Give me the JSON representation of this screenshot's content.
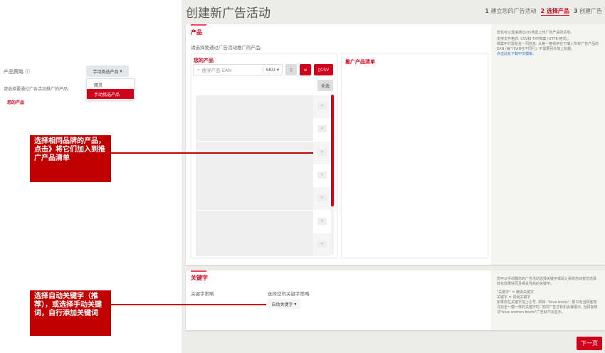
{
  "left_panel": {
    "strategy_label": "产品策略",
    "help_icon": "question-circle-icon",
    "strategy_button": "手动挑选产品",
    "dropdown_options": [
      "精灵",
      "手动挑选产品"
    ],
    "selected_option": "手动挑选产品",
    "prompt": "请选择要通过广告活动推广的产品:",
    "your_products": "您的产品"
  },
  "header": {
    "title": "创建新广告活动",
    "steps": [
      {
        "num": "1",
        "label": "建立您的广告活动"
      },
      {
        "num": "2",
        "label": "选择产品"
      },
      {
        "num": "3",
        "label": "创建广告"
      }
    ],
    "active_step": 2
  },
  "products": {
    "section_title": "产品",
    "prompt": "请选择要通过广告活动推广的产品:",
    "your_products": "您的产品",
    "search_placeholder": "搜寻产品 EAN",
    "search_type": "SKU",
    "csv_button": "CSV",
    "select_all": "全选",
    "move_glyph": "»",
    "row_count": 7,
    "target_title": "推广产品清单",
    "help": {
      "line1": "您也可以直接通过csv档案上传广告产品的清单。",
      "line2": "支持文件格式: CSV和 TXT档案 (UTF8-格式)。",
      "line3": "档案中只需包含一列信息, 从第一格依序往下填入所有广告产品的EAN (每个EAN在不同行), 不需要另外加上标题。",
      "link": "点击此处下载中文模板。"
    }
  },
  "keywords": {
    "section_title": "关键字",
    "strategy_label": "关键字策略",
    "choose_label": "选择您的关键字策略",
    "strategy_button": "自动关键字",
    "help": {
      "line1": "您可以手动翻您的广告活动选择关键字或是让系统自动替您选择转化效果好而且相关性高的关键字。",
      "line2": "\"关键字\" = 精准关键字",
      "line3": "关键字 = 词组关键字",
      "line4": "如果您在关键字加上引号, 例如: \"blue boots\", 那只有当顾客搜寻完全一模一样的关键字时, 您的广告才有机会被展示, 当顾客搜寻\"blue women boots\"广告就不会显示。"
    }
  },
  "next_button": "下一页",
  "annotations": {
    "products": "选择相同品牌的产品，点击》将它们加入到推广产品清单",
    "keywords": "选择自动关键字（推荐），或选择手动关键词，自行添加关键词"
  },
  "colors": {
    "accent": "#d0021b",
    "annotation": "#c00000",
    "background": "#ecece8"
  }
}
